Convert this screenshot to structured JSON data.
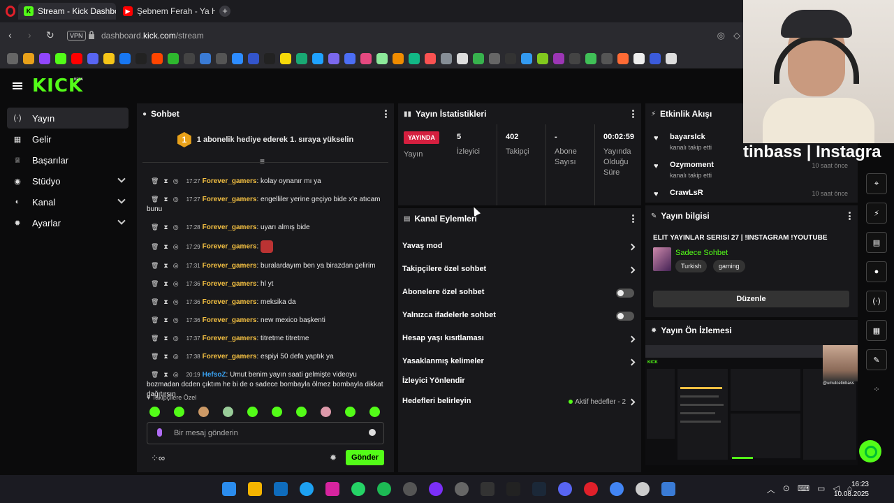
{
  "browser": {
    "tabs": [
      {
        "label": "Stream - Kick Dashboard",
        "active": true
      },
      {
        "label": "Şebnem Ferah - Ya He",
        "active": false
      }
    ],
    "url_prefix": "dashboard.",
    "url_domain": "kick.com",
    "url_path": "/stream",
    "vpn_label": "VPN"
  },
  "brand": {
    "logo": "KICK",
    "beta": "BETA",
    "accent": "#53fc18"
  },
  "sidebar": {
    "items": [
      {
        "label": "Yayın",
        "icon": "broadcast-icon"
      },
      {
        "label": "Gelir",
        "icon": "revenue-icon"
      },
      {
        "label": "Başarılar",
        "icon": "trophy-icon"
      },
      {
        "label": "Stüdyo",
        "icon": "studio-icon"
      },
      {
        "label": "Kanal",
        "icon": "channel-icon"
      },
      {
        "label": "Ayarlar",
        "icon": "settings-icon"
      }
    ]
  },
  "chat": {
    "title": "Sohbet",
    "banner_number": "1",
    "banner_text": "1 abonelik hediye ederek 1. sıraya yükselin",
    "messages": [
      {
        "time": "17:27",
        "user": "Forever_gamers",
        "text": "kolay oynanır mı ya"
      },
      {
        "time": "17:27",
        "user": "Forever_gamers",
        "text": "engelliler yerine geçiyo bide x'e atıcam bunu"
      },
      {
        "time": "17:28",
        "user": "Forever_gamers",
        "text": "uyarı almış bide"
      },
      {
        "time": "17:29",
        "user": "Forever_gamers",
        "text": ""
      },
      {
        "time": "17:31",
        "user": "Forever_gamers",
        "text": "buralardayım ben ya birazdan gelirim"
      },
      {
        "time": "17:36",
        "user": "Forever_gamers",
        "text": "hl yt"
      },
      {
        "time": "17:36",
        "user": "Forever_gamers",
        "text": "meksika da"
      },
      {
        "time": "17:36",
        "user": "Forever_gamers",
        "text": "new mexico başkenti"
      },
      {
        "time": "17:37",
        "user": "Forever_gamers",
        "text": "titretme titretme"
      },
      {
        "time": "17:38",
        "user": "Forever_gamers",
        "text": "espiyi 50 defa yaptık ya"
      },
      {
        "time": "20:19",
        "user": "HefsoZ",
        "text": "Umut benim yayın saati gelmişte videoyu bozmadan dcden çıktım he bi de o sadece bombayla ölmez bombayla dikkat dağıtırsın"
      }
    ],
    "followers_label": "Takipçilere Özel",
    "input_placeholder": "Bir mesaj gönderin",
    "send_label": "Gönder"
  },
  "stats": {
    "title": "Yayın İstatistikleri",
    "live_badge": "YAYINDA",
    "items": [
      {
        "value": "",
        "label": "Yayın"
      },
      {
        "value": "5",
        "label": "İzleyici"
      },
      {
        "value": "402",
        "label": "Takipçi"
      },
      {
        "value": "-",
        "label": "Abone Sayısı"
      },
      {
        "value": "00:02:59",
        "label": "Yayında Olduğu Süre"
      }
    ]
  },
  "actions": {
    "title": "Kanal Eylemleri",
    "rows": [
      {
        "label": "Yavaş mod",
        "control": "chevron"
      },
      {
        "label": "Takipçilere özel sohbet",
        "control": "chevron"
      },
      {
        "label": "Abonelere özel sohbet",
        "control": "toggle"
      },
      {
        "label": "Yalnızca ifadelerle sohbet",
        "control": "toggle"
      },
      {
        "label": "Hesap yaşı kısıtlaması",
        "control": "chevron"
      },
      {
        "label": "Yasaklanmış kelimeler",
        "control": "chevron"
      },
      {
        "label": "İzleyici Yönlendir",
        "control": "none"
      },
      {
        "label": "Hedefleri belirleyin",
        "control": "chevron"
      }
    ],
    "goals_text": "Aktif hedefler - 2"
  },
  "activity": {
    "title": "Etkinlik Akışı",
    "items": [
      {
        "name": "bayarsIck",
        "desc": "kanalı takip etti",
        "when": ""
      },
      {
        "name": "Ozymoment",
        "desc": "kanalı takip etti",
        "when": "10 saat önce"
      },
      {
        "name": "CrawLsR",
        "desc": "",
        "when": "10 saat önce"
      }
    ]
  },
  "info": {
    "title": "Yayın bilgisi",
    "stream_title": "ELIT YAYINLAR SERISI 27 | !INSTAGRAM !YOUTUBE",
    "category": "Sadece Sohbet",
    "tags": [
      "Turkish",
      "gaming"
    ],
    "edit_label": "Düzenle"
  },
  "preview": {
    "title": "Yayın Ön İzlemesi",
    "watermark": "@umutcetinbass"
  },
  "overlay": {
    "text": "tinbass | Instagra"
  },
  "clock": {
    "time": "16:23",
    "date": "10.08.2025"
  }
}
